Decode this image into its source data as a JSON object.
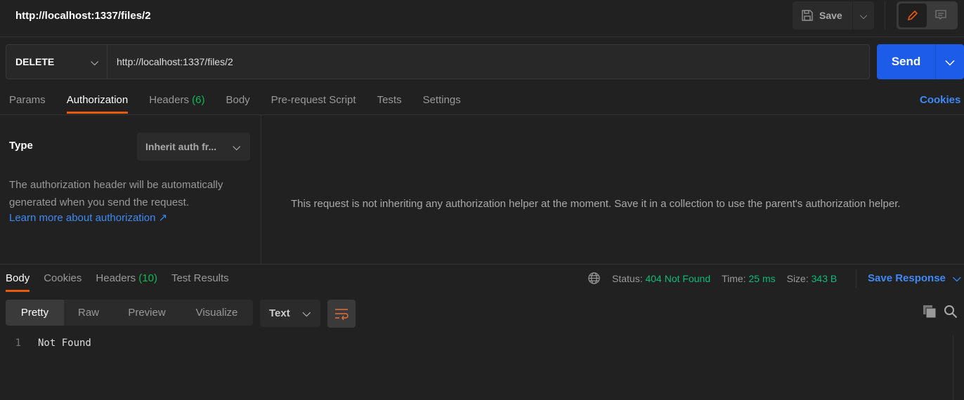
{
  "header": {
    "title": "http://localhost:1337/files/2",
    "save_label": "Save"
  },
  "request": {
    "method": "DELETE",
    "url": "http://localhost:1337/files/2",
    "send_label": "Send"
  },
  "request_tabs": [
    {
      "label": "Params"
    },
    {
      "label": "Authorization",
      "active": true
    },
    {
      "label": "Headers",
      "count": "(6)"
    },
    {
      "label": "Body"
    },
    {
      "label": "Pre-request Script"
    },
    {
      "label": "Tests"
    },
    {
      "label": "Settings"
    }
  ],
  "cookies_label": "Cookies",
  "auth": {
    "type_label": "Type",
    "type_value": "Inherit auth fr...",
    "description": "The authorization header will be automatically generated when you send the request.",
    "learn_more": "Learn more about authorization ↗",
    "inherit_message": "This request is not inheriting any authorization helper at the moment. Save it in a collection to use the parent's authorization helper."
  },
  "response_tabs": [
    {
      "label": "Body",
      "active": true
    },
    {
      "label": "Cookies"
    },
    {
      "label": "Headers",
      "count": "(10)"
    },
    {
      "label": "Test Results"
    }
  ],
  "response_meta": {
    "status_label": "Status:",
    "status": "404 Not Found",
    "time_label": "Time:",
    "time": "25 ms",
    "size_label": "Size:",
    "size": "343 B",
    "save_response": "Save Response"
  },
  "view_modes": [
    "Pretty",
    "Raw",
    "Preview",
    "Visualize"
  ],
  "format": "Text",
  "body_lines": [
    {
      "n": "1",
      "text": "Not Found"
    }
  ],
  "colors": {
    "accent": "#e8590c",
    "send": "#1c5ce8",
    "link": "#3d8af7",
    "success": "#0cbb7a"
  }
}
